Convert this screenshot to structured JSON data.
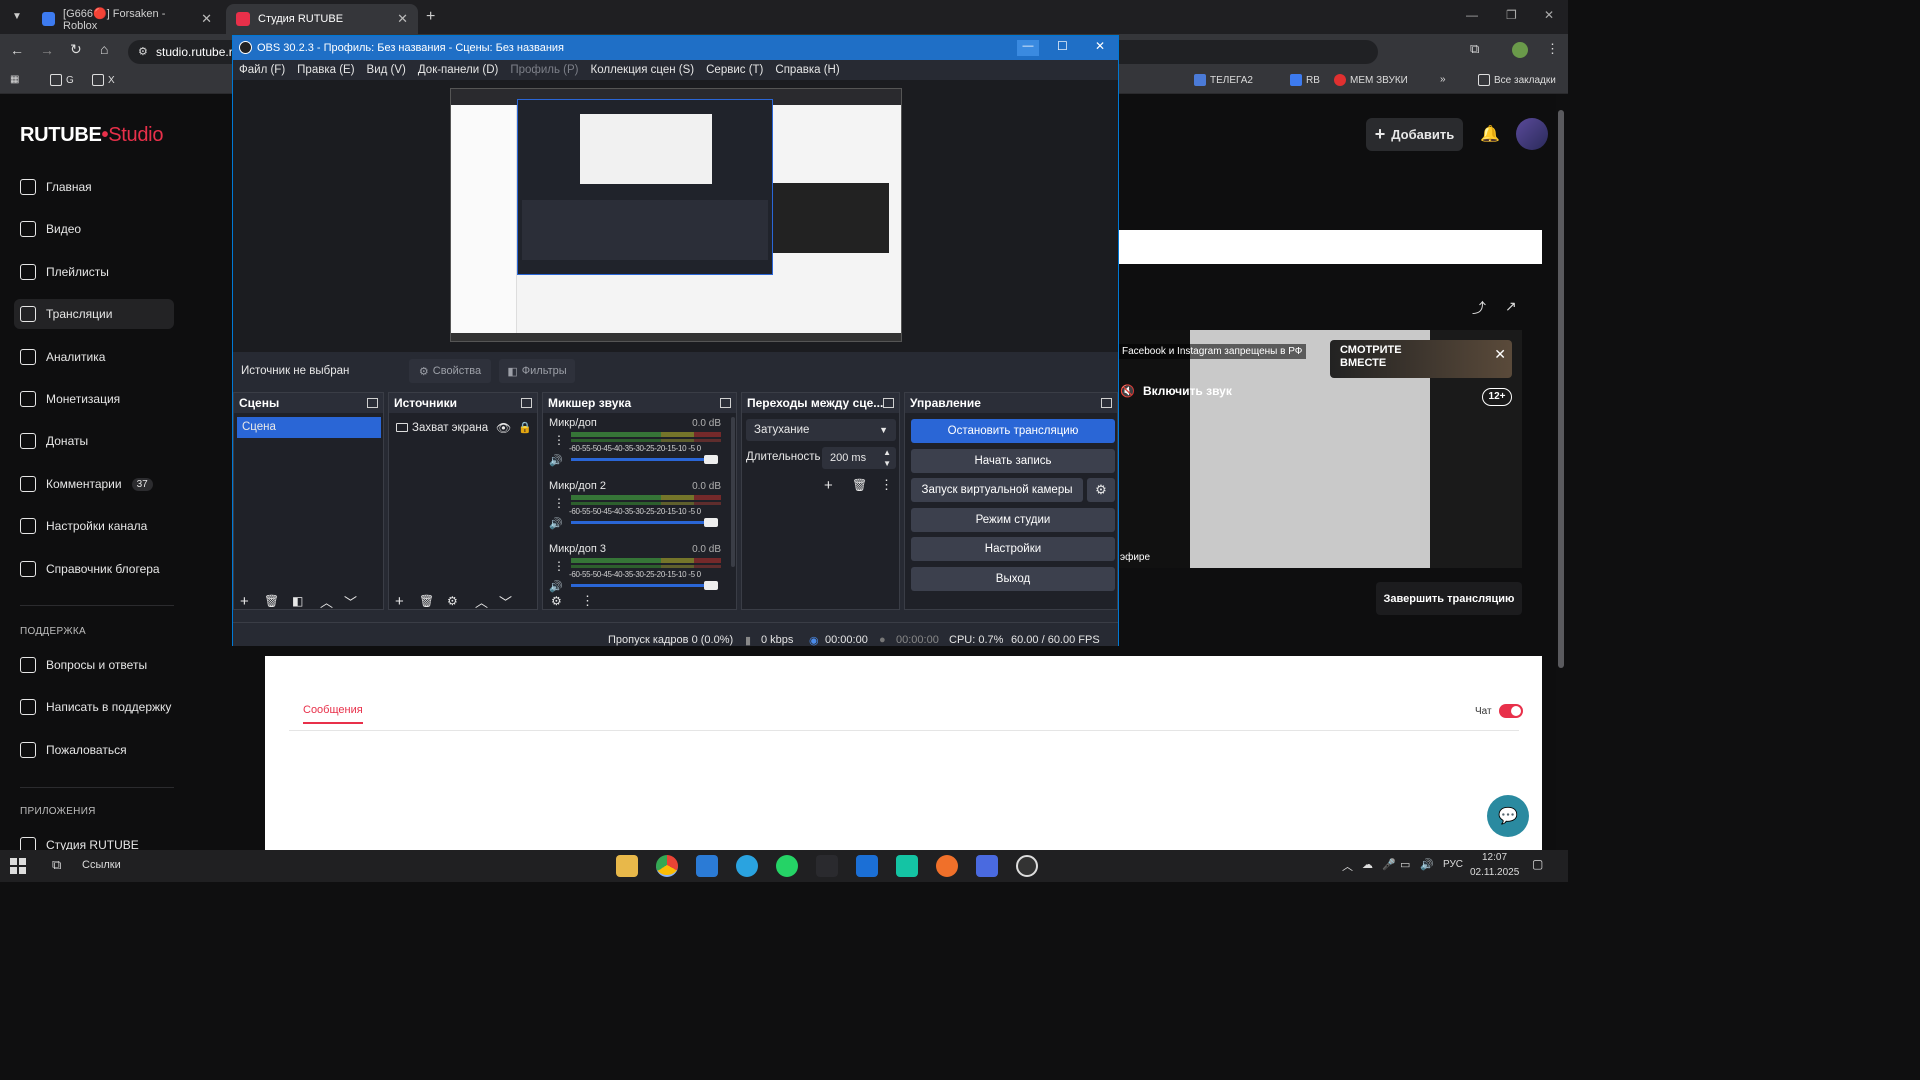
{
  "browser": {
    "tabs": [
      {
        "label": "[G666🔴] Forsaken - Roblox"
      },
      {
        "label": "Студия RUTUBE"
      }
    ],
    "address": "studio.rutube.r",
    "bookmarks_left": [
      "G",
      "X"
    ],
    "bookmarks_right": [
      "ТЕЛЕГА2",
      "RB",
      "МЕМ ЗВУКИ"
    ],
    "all_bookmarks": "Все закладки"
  },
  "rutube": {
    "logo": "RUTUBE",
    "logo_studio": "Studio",
    "add_button": "Добавить",
    "nav": [
      {
        "label": "Главная",
        "icon": "home-icon"
      },
      {
        "label": "Видео",
        "icon": "video-icon"
      },
      {
        "label": "Плейлисты",
        "icon": "playlist-icon"
      },
      {
        "label": "Трансляции",
        "icon": "broadcast-icon",
        "selected": true
      },
      {
        "label": "Аналитика",
        "icon": "analytics-icon"
      },
      {
        "label": "Монетизация",
        "icon": "monetization-icon"
      },
      {
        "label": "Донаты",
        "icon": "donate-icon"
      },
      {
        "label": "Комментарии",
        "icon": "comments-icon",
        "badge": "37"
      },
      {
        "label": "Настройки канала",
        "icon": "settings-icon"
      },
      {
        "label": "Справочник блогера",
        "icon": "info-icon"
      }
    ],
    "support_title": "ПОДДЕРЖКА",
    "support": [
      {
        "label": "Вопросы и ответы",
        "icon": "question-icon"
      },
      {
        "label": "Написать в поддержку",
        "icon": "mail-icon"
      },
      {
        "label": "Пожаловаться",
        "icon": "flag-icon"
      }
    ],
    "apps_title": "ПРИЛОЖЕНИЯ",
    "apps": [
      {
        "label": "Студия RUTUBE",
        "icon": "studio-app-icon"
      }
    ],
    "player": {
      "notice": "Facebook и Instagram запрещены в РФ",
      "unmute": "Включить звук",
      "age": "12+",
      "live": "эфире",
      "promo": "СМОТРИТЕ ВМЕСТЕ"
    },
    "end_stream": "Завершить трансляцию",
    "messages_tab": "Сообщения",
    "chat_label": "Чат",
    "chat_enabled": true
  },
  "obs": {
    "title": "OBS 30.2.3 - Профиль: Без названия - Сцены: Без названия",
    "menu": [
      {
        "label": "Файл (F)",
        "disabled": false
      },
      {
        "label": "Правка (E)",
        "disabled": false
      },
      {
        "label": "Вид (V)",
        "disabled": false
      },
      {
        "label": "Док-панели (D)",
        "disabled": false
      },
      {
        "label": "Профиль (P)",
        "disabled": true
      },
      {
        "label": "Коллекция сцен (S)",
        "disabled": false
      },
      {
        "label": "Сервис (T)",
        "disabled": false
      },
      {
        "label": "Справка (H)",
        "disabled": false
      }
    ],
    "no_source": "Источник не выбран",
    "properties": "Свойства",
    "filters": "Фильтры",
    "scenes": {
      "title": "Сцены",
      "items": [
        "Сцена"
      ]
    },
    "sources": {
      "title": "Источники",
      "items": [
        "Захват экрана"
      ]
    },
    "mixer": {
      "title": "Микшер звука",
      "scale": "-60-55-50-45-40-35-30-25-20-15-10 -5  0",
      "channels": [
        {
          "name": "Микр/доп",
          "db": "0.0 dB",
          "volume": 1.0
        },
        {
          "name": "Микр/доп 2",
          "db": "0.0 dB",
          "volume": 1.0
        },
        {
          "name": "Микр/доп 3",
          "db": "0.0 dB",
          "volume": 1.0
        }
      ]
    },
    "transitions": {
      "title": "Переходы между сце...",
      "selected": "Затухание",
      "duration_label": "Длительность",
      "duration_value": "200 ms"
    },
    "controls": {
      "title": "Управление",
      "stop_stream": "Остановить трансляцию",
      "start_record": "Начать запись",
      "virtual_cam": "Запуск виртуальной камеры",
      "studio_mode": "Режим студии",
      "settings": "Настройки",
      "exit": "Выход"
    },
    "status": {
      "dropped": "Пропуск кадров 0 (0.0%)",
      "bitrate": "0 kbps",
      "stream_time": "00:00:00",
      "record_time": "00:00:00",
      "cpu": "CPU: 0.7%",
      "fps": "60.00 / 60.00 FPS"
    }
  },
  "taskbar": {
    "search": "Ссылки",
    "lang": "РУС",
    "time": "12:07",
    "date": "02.11.2025"
  },
  "colors": {
    "accent_red": "#e8304a",
    "obs_blue": "#2a66d6",
    "titlebar_blue": "#1f6fc6"
  }
}
